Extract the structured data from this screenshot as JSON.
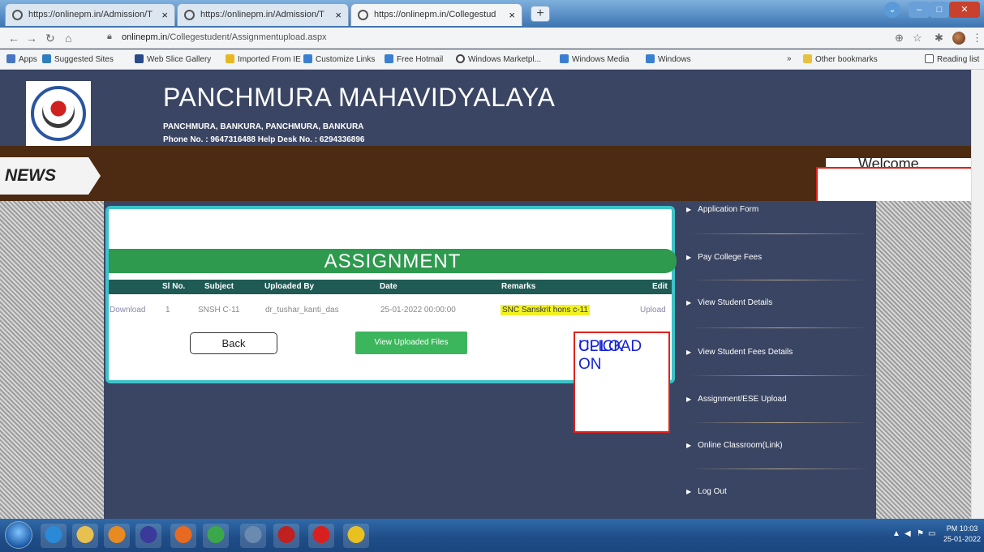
{
  "browser": {
    "tabs": [
      {
        "title": "https://onlinepm.in/Admission/T"
      },
      {
        "title": "https://onlinepm.in/Admission/T"
      },
      {
        "title": "https://onlinepm.in/Collegestud"
      }
    ],
    "new_tab_label": "+",
    "address": {
      "domain": "onlinepm.in",
      "path": "/Collegestudent/Assignmentupload.aspx"
    },
    "bookmarks": [
      {
        "label": "Apps",
        "color": "#4a76c0"
      },
      {
        "label": "Suggested Sites",
        "color": "#2f7fc0"
      },
      {
        "label": "Web Slice Gallery",
        "color": "#2a4a8a"
      },
      {
        "label": "Imported From IE",
        "color": "#e8b820"
      },
      {
        "label": "Customize Links",
        "color": "#3a7fd0"
      },
      {
        "label": "Free Hotmail",
        "color": "#3a7fd0"
      },
      {
        "label": "Windows Marketpl...",
        "color": "#444444"
      },
      {
        "label": "Windows Media",
        "color": "#3a7fd0"
      },
      {
        "label": "Windows",
        "color": "#3a7fd0"
      }
    ],
    "more_bookmarks": "»",
    "other_bookmarks": "Other bookmarks",
    "reading_list": "Reading list"
  },
  "header": {
    "college_name": "PANCHMURA MAHAVIDYALAYA",
    "address": "PANCHMURA, BANKURA, PANCHMURA, BANKURA",
    "phone": "Phone No. : 9647316488   Help Desk No. : 6294336896"
  },
  "news": {
    "label": "NEWS",
    "welcome": "Welcome"
  },
  "assignment": {
    "title": "ASSIGNMENT",
    "columns": [
      "Sl No.",
      "Subject",
      "Uploaded By",
      "Date",
      "Remarks",
      "Edit"
    ],
    "row": {
      "download": "Download",
      "sl_no": "1",
      "subject": "SNSH C-11",
      "uploaded_by": "dr_tushar_kanti_das",
      "date": "25-01-2022 00:00:00",
      "remarks": "SNC Sanskrit hons c-11",
      "edit": "Upload"
    },
    "back_label": "Back",
    "view_label": "View Uploaded Files"
  },
  "annotation": {
    "line1": "CLICK ON",
    "line2": "UPLOAD"
  },
  "sidebar": {
    "items": [
      {
        "label": "Application Form"
      },
      {
        "label": "Pay College Fees"
      },
      {
        "label": "View Student Details"
      },
      {
        "label": "View Student Fees Details"
      },
      {
        "label": "Assignment/ESE Upload"
      },
      {
        "label": "Online Classroom(Link)"
      },
      {
        "label": "Log Out"
      }
    ]
  },
  "taskbar": {
    "icons": [
      {
        "name": "internet-explorer-icon",
        "color": "#2a8ad8"
      },
      {
        "name": "file-explorer-icon",
        "color": "#e8c050"
      },
      {
        "name": "media-player-icon",
        "color": "#e88a20"
      },
      {
        "name": "media-center-icon",
        "color": "#3a3a9a"
      },
      {
        "name": "firefox-icon",
        "color": "#e86a20"
      },
      {
        "name": "chrome-icon",
        "color": "#3aa84a"
      },
      {
        "name": "calculator-icon",
        "color": "#6a8ab0"
      },
      {
        "name": "html-editor-icon",
        "color": "#c02020"
      },
      {
        "name": "acrobat-icon",
        "color": "#d82020"
      },
      {
        "name": "chrome-active-icon",
        "color": "#e8c020"
      }
    ],
    "time": "PM 10:03",
    "date": "25-01-2022"
  }
}
